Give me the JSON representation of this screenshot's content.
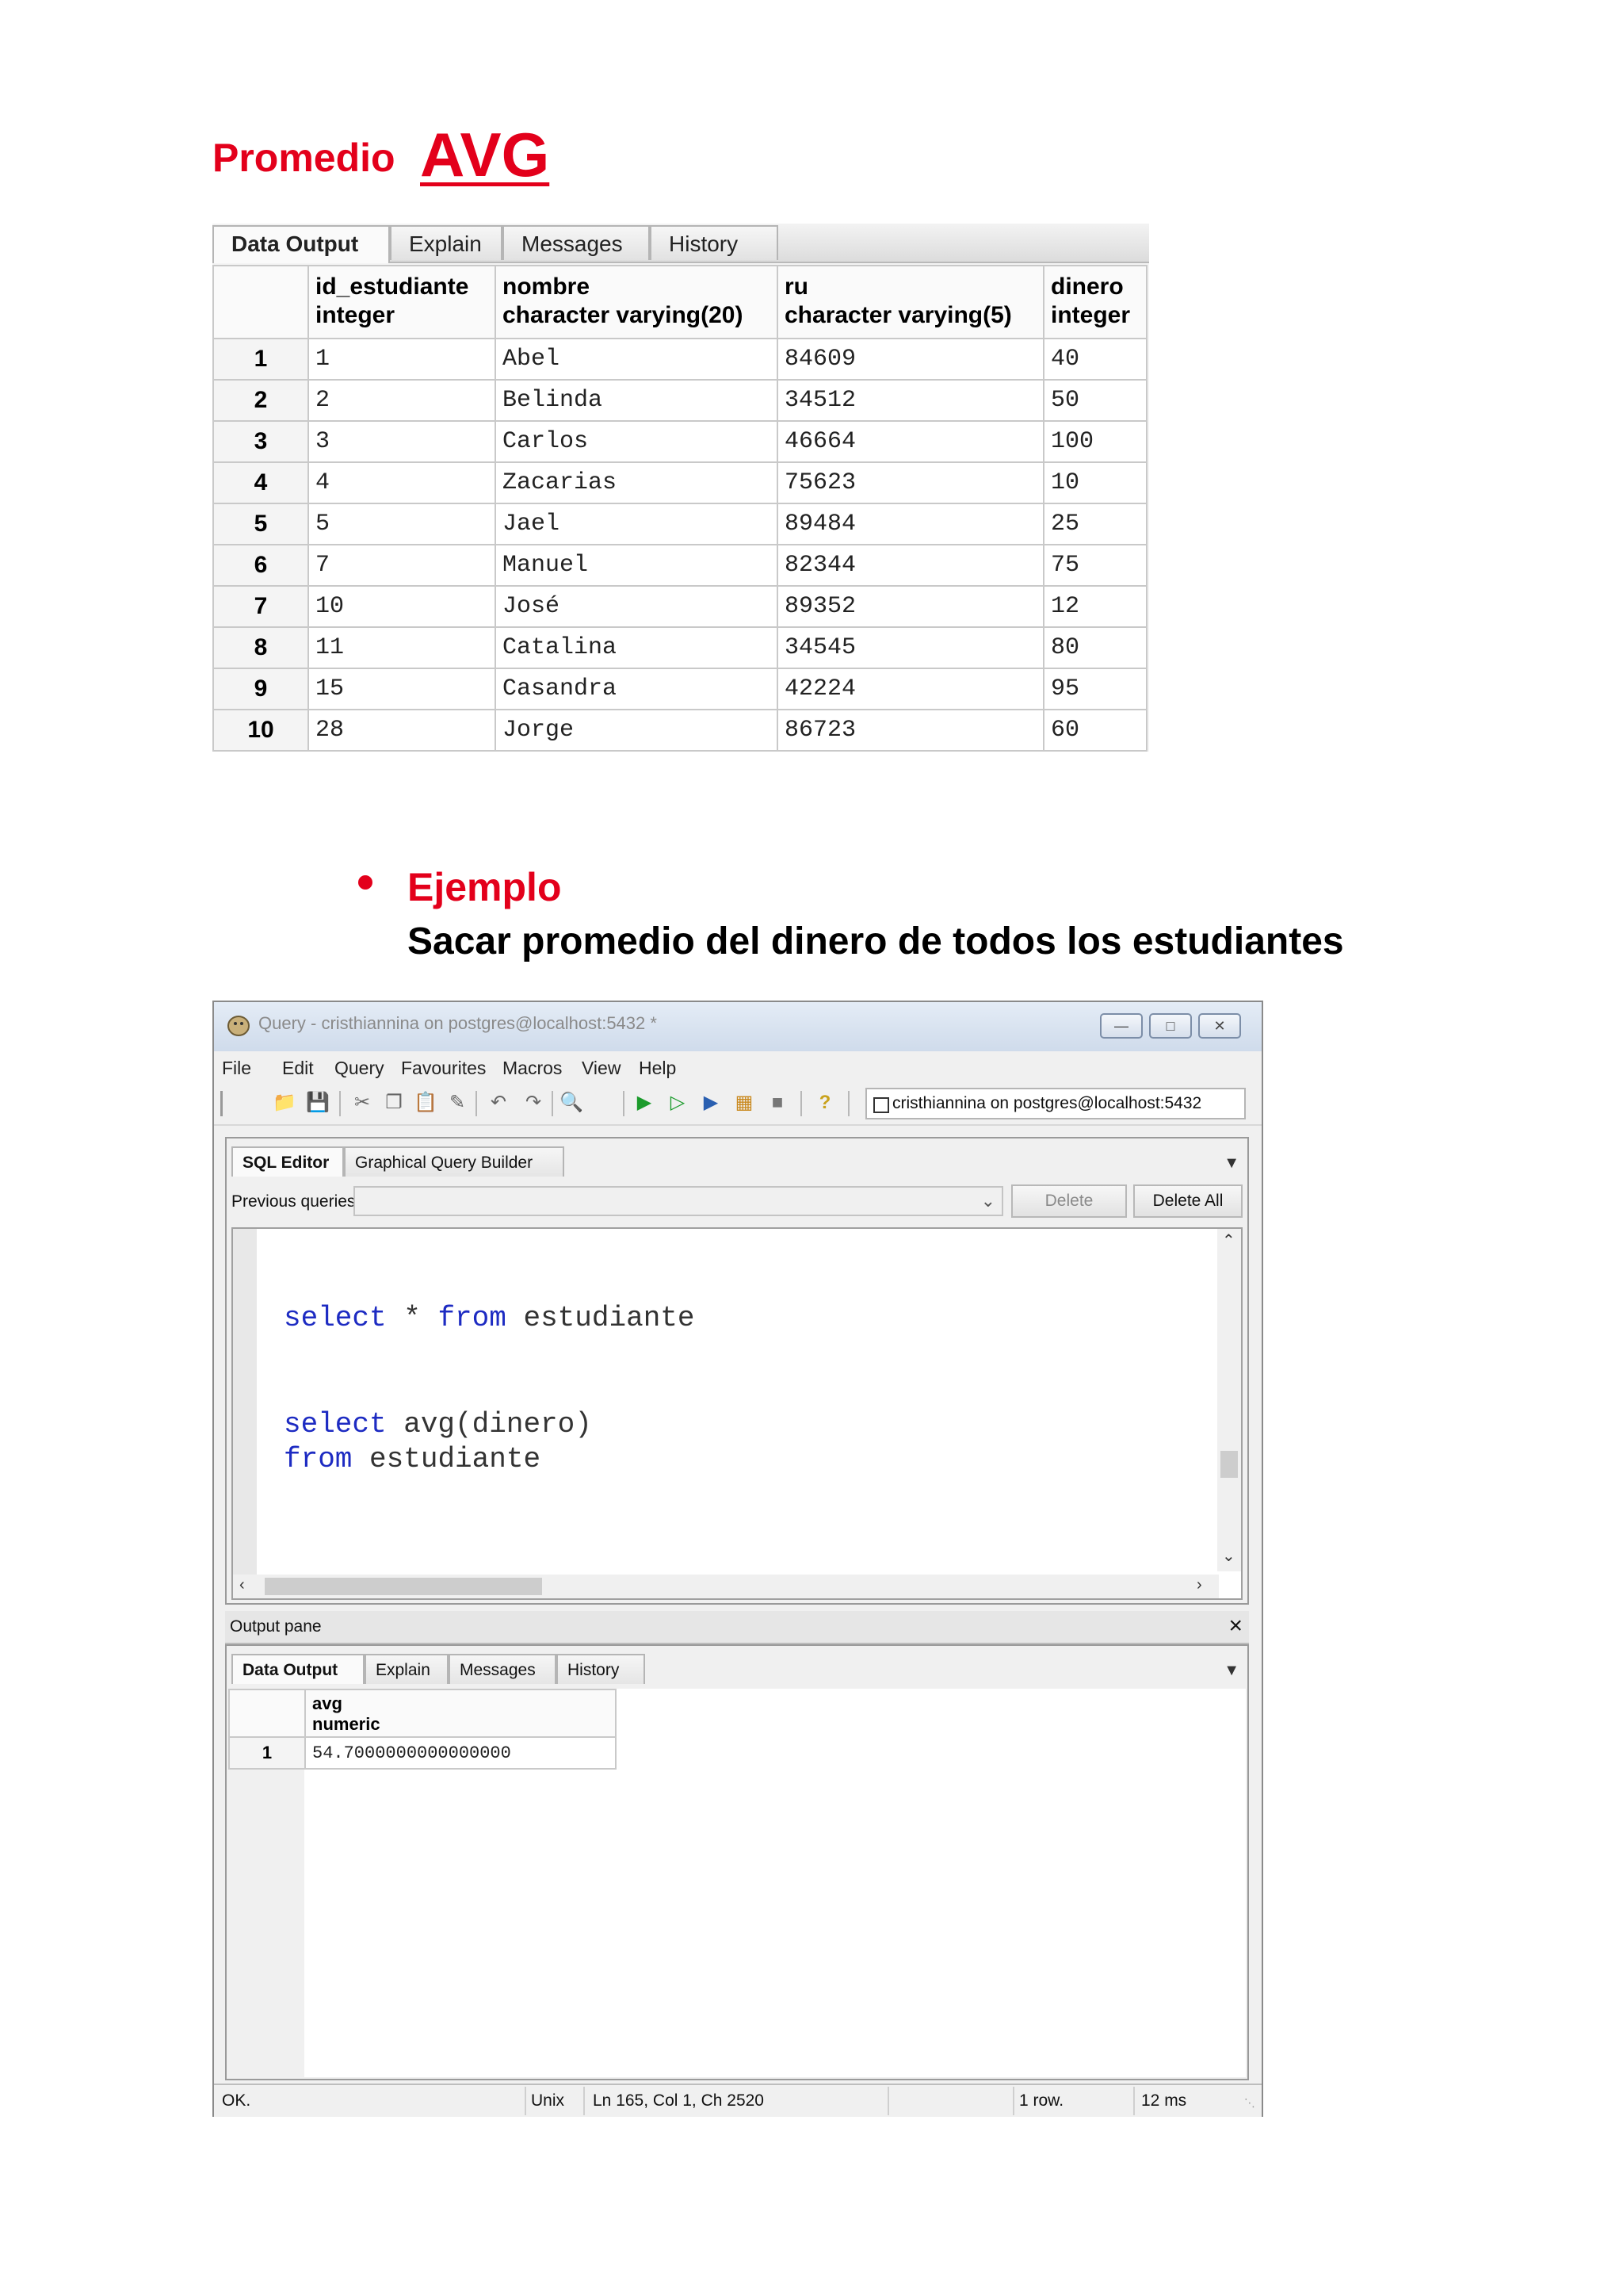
{
  "heading": {
    "label": "Promedio",
    "func": "AVG"
  },
  "top_grid": {
    "tabs": [
      "Data Output",
      "Explain",
      "Messages",
      "History"
    ],
    "columns": [
      {
        "name": "id_estudiante",
        "type": "integer"
      },
      {
        "name": "nombre",
        "type": "character varying(20)"
      },
      {
        "name": "ru",
        "type": "character varying(5)"
      },
      {
        "name": "dinero",
        "type": "integer"
      }
    ],
    "rows": [
      {
        "n": "1",
        "id": "1",
        "nombre": "Abel",
        "ru": "84609",
        "dinero": "40"
      },
      {
        "n": "2",
        "id": "2",
        "nombre": "Belinda",
        "ru": "34512",
        "dinero": "50"
      },
      {
        "n": "3",
        "id": "3",
        "nombre": "Carlos",
        "ru": "46664",
        "dinero": "100"
      },
      {
        "n": "4",
        "id": "4",
        "nombre": "Zacarias",
        "ru": "75623",
        "dinero": "10"
      },
      {
        "n": "5",
        "id": "5",
        "nombre": "Jael",
        "ru": "89484",
        "dinero": "25"
      },
      {
        "n": "6",
        "id": "7",
        "nombre": "Manuel",
        "ru": "82344",
        "dinero": "75"
      },
      {
        "n": "7",
        "id": "10",
        "nombre": "José",
        "ru": "89352",
        "dinero": "12"
      },
      {
        "n": "8",
        "id": "11",
        "nombre": "Catalina",
        "ru": "34545",
        "dinero": "80"
      },
      {
        "n": "9",
        "id": "15",
        "nombre": "Casandra",
        "ru": "42224",
        "dinero": "95"
      },
      {
        "n": "10",
        "id": "28",
        "nombre": "Jorge",
        "ru": "86723",
        "dinero": "60"
      }
    ]
  },
  "example": {
    "label": "Ejemplo",
    "description": "Sacar promedio del dinero de todos los estudiantes"
  },
  "window": {
    "title": "Query - cristhiannina on postgres@localhost:5432 *",
    "menu": [
      "File",
      "Edit",
      "Query",
      "Favourites",
      "Macros",
      "View",
      "Help"
    ],
    "connection": "cristhiannina on postgres@localhost:5432",
    "editor_tabs": [
      "SQL Editor",
      "Graphical Query Builder"
    ],
    "previous_queries_label": "Previous queries",
    "delete_label": "Delete",
    "delete_all_label": "Delete All",
    "code": {
      "line1": {
        "kw1": "select",
        "mid": " * ",
        "kw2": "from",
        "rest": " estudiante"
      },
      "line2": {
        "kw1": "select",
        "rest": " avg(dinero)"
      },
      "line3": {
        "kw1": "from",
        "rest": " estudiante"
      }
    },
    "output_pane_label": "Output pane",
    "output_tabs": [
      "Data Output",
      "Explain",
      "Messages",
      "History"
    ],
    "result": {
      "column": {
        "name": "avg",
        "type": "numeric"
      },
      "row_number": "1",
      "value": "54.7000000000000000"
    },
    "status": {
      "state": "OK.",
      "line_ending": "Unix",
      "position": "Ln 165, Col 1, Ch 2520",
      "rows": "1 row.",
      "time": "12 ms"
    }
  },
  "colors": {
    "accent_red": "#e3001b",
    "keyword_blue": "#1d2bc2"
  },
  "icons": [
    "app-icon",
    "open-icon",
    "save-icon",
    "cut-icon",
    "copy-icon",
    "paste-icon",
    "clear-icon",
    "undo-icon",
    "redo-icon",
    "find-icon",
    "execute-icon",
    "explain-icon",
    "execute-file-icon",
    "explain-analyze-icon",
    "stop-icon",
    "help-icon"
  ]
}
